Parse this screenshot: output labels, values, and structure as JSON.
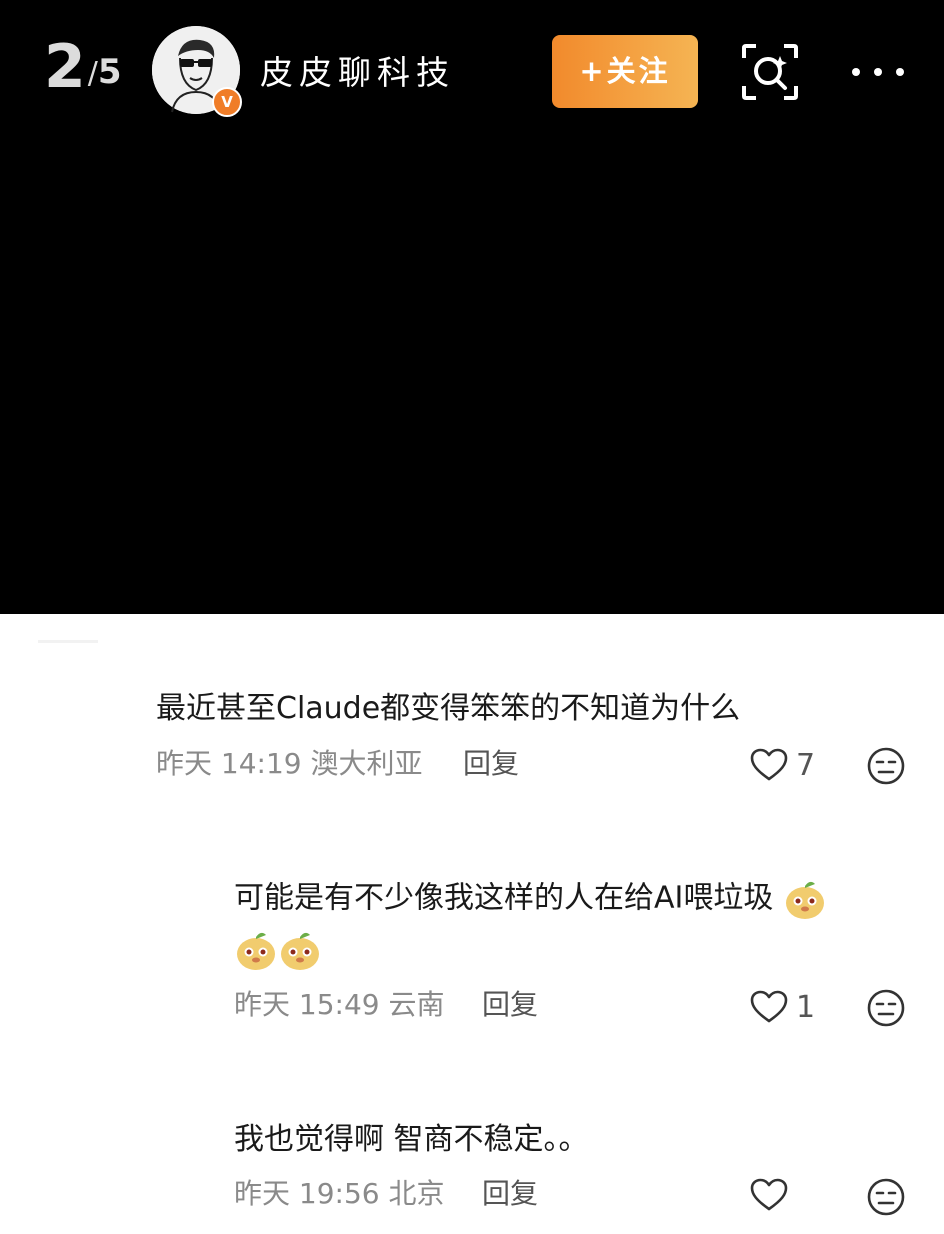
{
  "header": {
    "page_current": "2",
    "page_separator": "/",
    "page_total": "5",
    "author_name": "皮皮聊科技",
    "verified_badge": "V",
    "follow_label": "+关注",
    "icons": {
      "scan": "scan-search-icon",
      "more": "more-dots-icon"
    }
  },
  "comments": [
    {
      "text": "最近甚至Claude都变得笨笨的不知道为什么",
      "time": "昨天 14:19",
      "location": "澳大利亚",
      "reply_label": "回复",
      "likes": "7"
    },
    {
      "text_line1": "可能是有不少像我这样的人在给AI喂垃圾",
      "emoji_count": 3,
      "time": "昨天 15:49",
      "location": "云南",
      "reply_label": "回复",
      "likes": "1"
    },
    {
      "text": "我也觉得啊 智商不稳定。。",
      "time": "昨天 19:56",
      "location": "北京",
      "reply_label": "回复",
      "likes": ""
    }
  ],
  "colors": {
    "follow_start": "#f28a2c",
    "follow_end": "#f5b453",
    "verified": "#f07d28"
  }
}
